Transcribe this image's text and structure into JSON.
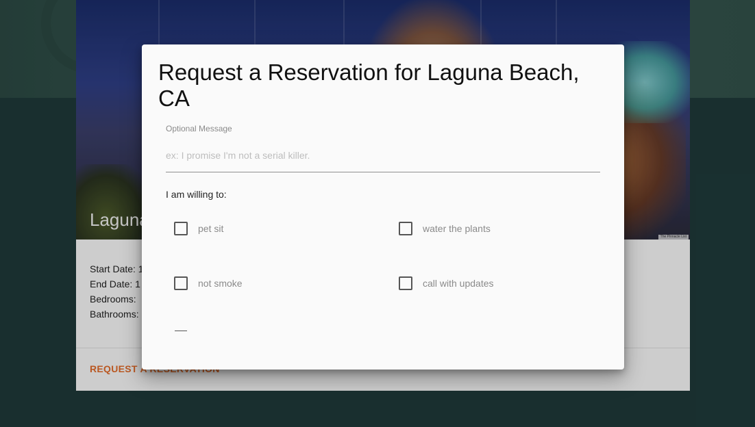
{
  "listing": {
    "title": "Laguna Beach, CA",
    "photo_credit": "The Pinnacle List",
    "details": [
      "Start Date: 1",
      "End Date: 1",
      "Bedrooms:",
      "Bathrooms:"
    ],
    "action_label": "Request a Reservation"
  },
  "dialog": {
    "title": "Request a Reservation for Laguna Beach, CA",
    "message": {
      "label": "Optional Message",
      "placeholder": "ex: I promise I'm not a serial killer.",
      "value": ""
    },
    "willing_label": "I am willing to:",
    "options": [
      {
        "label": "pet sit",
        "checked": false
      },
      {
        "label": "water the plants",
        "checked": false
      },
      {
        "label": "not smoke",
        "checked": false
      },
      {
        "label": "call with updates",
        "checked": false
      }
    ]
  },
  "colors": {
    "accent": "#e36c2a",
    "page_background": "#1f3a3a",
    "dialog_background": "#fafafa"
  }
}
